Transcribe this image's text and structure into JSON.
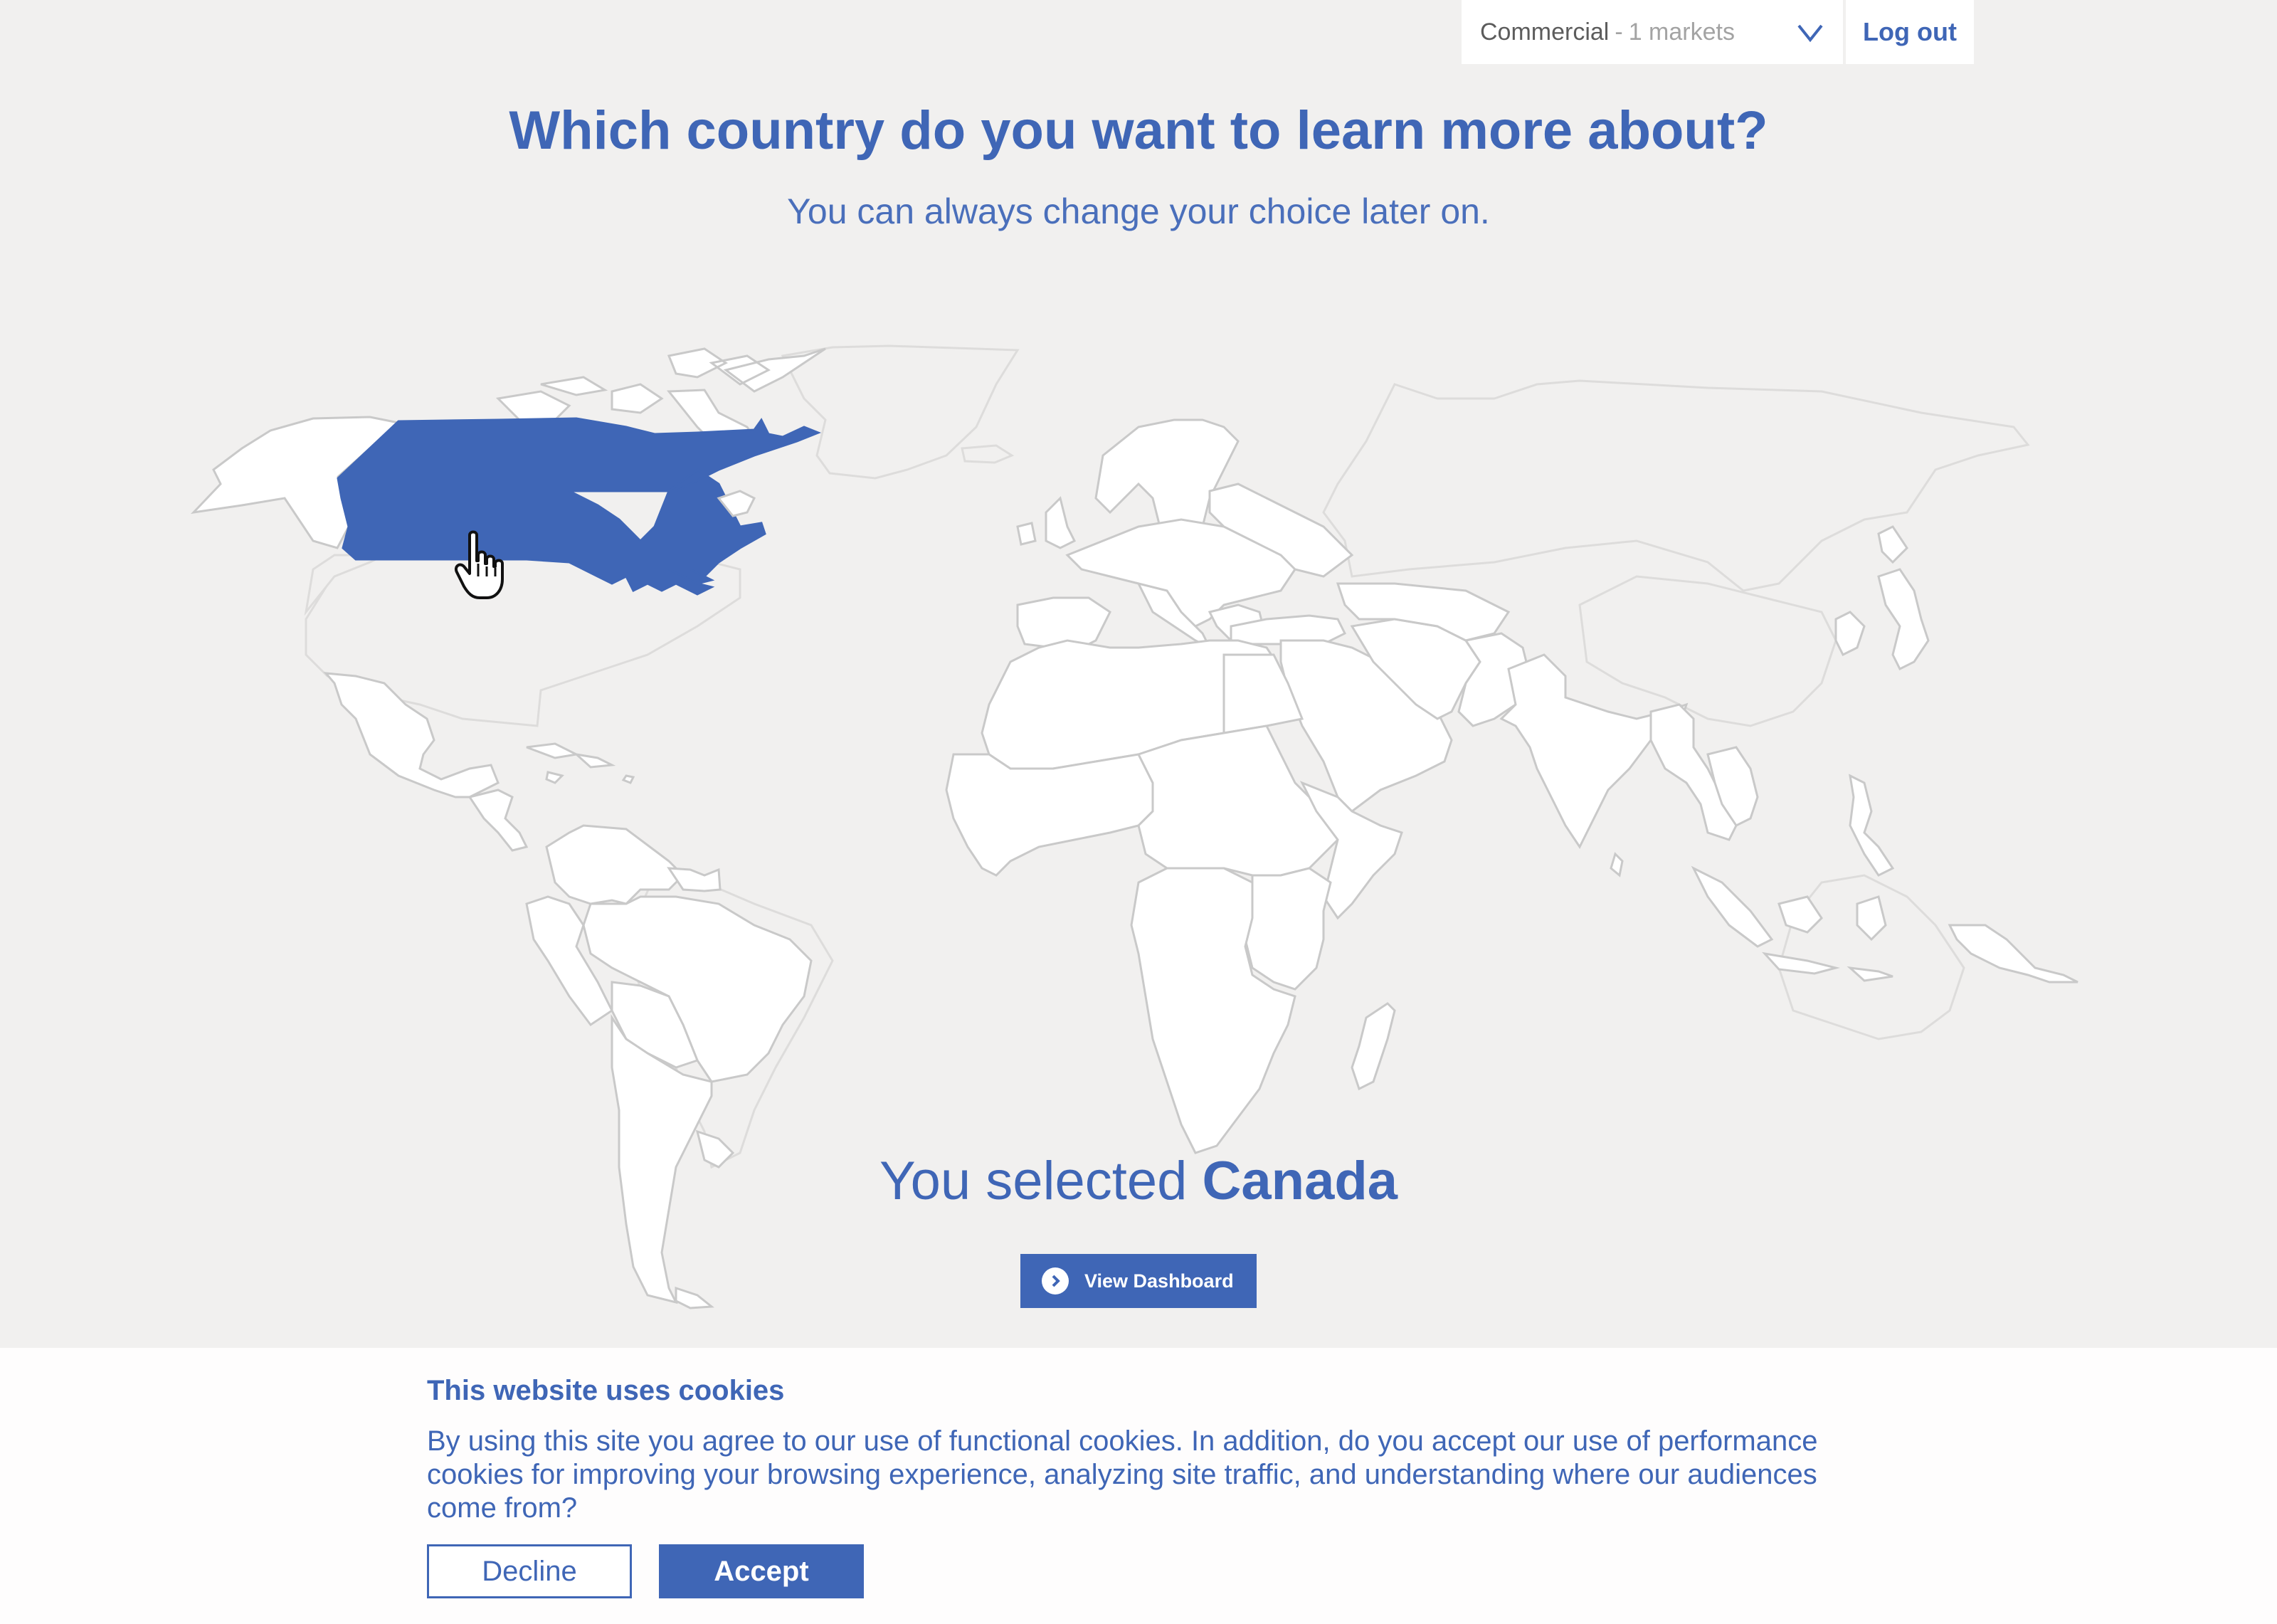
{
  "header": {
    "segment_name": "Commercial",
    "segment_separator": "-",
    "segment_count": "1 markets",
    "logout_label": "Log out"
  },
  "main": {
    "title": "Which country do you want to learn more about?",
    "subtitle": "You can always change your choice later on.",
    "selected_prefix": "You selected",
    "selected_country": "Canada",
    "view_dashboard_label": "View Dashboard"
  },
  "cookie_banner": {
    "title": "This website uses cookies",
    "text": "By using this site you agree to our use of functional cookies. In addition, do you accept our use of performance cookies for improving your browsing experience, analyzing site traffic, and understanding where our audiences come from?",
    "decline_label": "Decline",
    "accept_label": "Accept"
  },
  "colors": {
    "accent": "#3f66b6",
    "background": "#f1f0ef",
    "map_land": "#ffffff",
    "map_border": "#c9c9c9"
  },
  "icons": {
    "dropdown": "chevron-down-icon",
    "view_dashboard": "circle-arrow-right-icon",
    "cursor": "hand-pointer-icon"
  }
}
